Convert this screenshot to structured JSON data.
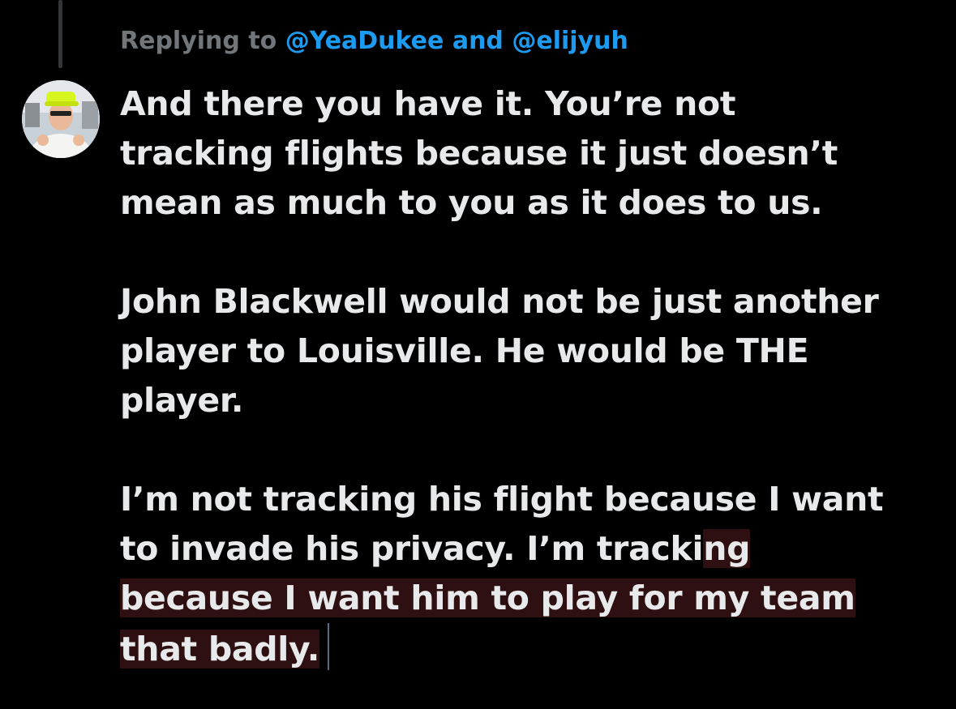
{
  "reply": {
    "prefix": "Replying to ",
    "handle1": "@YeaDukee",
    "joiner": " and ",
    "handle2": "@elijyuh"
  },
  "avatar": {
    "icon": "profile-photo-icon",
    "accent": "#d7f51f"
  },
  "tweet": {
    "paragraphs": [
      {
        "lines": [
          "And there you have it. You’re not",
          "tracking flights because it just doesn’t",
          "mean as much to you as it does to us."
        ]
      },
      {
        "lines": [
          "John Blackwell would not be just another",
          "player to Louisville. He would be THE",
          "player."
        ]
      },
      {
        "line1": "I’m not tracking his flight because I want",
        "line2_plain": "to invade his privacy. I’m tracki",
        "line2_selected": "ng",
        "line3": "because I want him to play for my team",
        "line4": "that badly."
      }
    ]
  },
  "colors": {
    "background": "#000000",
    "text": "#e7e9ea",
    "muted": "#71767b",
    "link": "#1d9bf0",
    "selection": "#2e1012"
  }
}
